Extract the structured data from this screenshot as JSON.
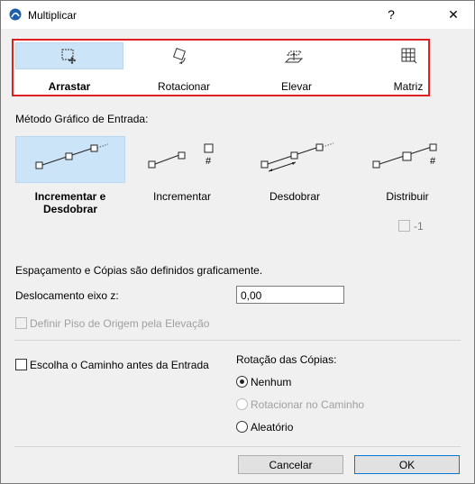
{
  "window": {
    "title": "Multiplicar",
    "help_glyph": "?",
    "close_glyph": "✕"
  },
  "modes": [
    {
      "label": "Arrastar",
      "icon": "drag-icon",
      "selected": true
    },
    {
      "label": "Rotacionar",
      "icon": "rotate-icon",
      "selected": false
    },
    {
      "label": "Elevar",
      "icon": "elevate-icon",
      "selected": false
    },
    {
      "label": "Matriz",
      "icon": "matrix-icon",
      "selected": false
    }
  ],
  "method_section": {
    "label": "Método Gráfico de Entrada:",
    "options": [
      {
        "label_line1": "Incrementar e",
        "label_line2": "Desdobrar",
        "selected": true
      },
      {
        "label_line1": "Incrementar",
        "label_line2": "",
        "selected": false
      },
      {
        "label_line1": "Desdobrar",
        "label_line2": "",
        "selected": false
      },
      {
        "label_line1": "Distribuir",
        "label_line2": "",
        "selected": false
      }
    ],
    "minus_one_label": "-1"
  },
  "spacing_note": "Espaçamento e Cópias são definidos graficamente.",
  "z_offset": {
    "label": "Deslocamento eixo z:",
    "value": "0,00"
  },
  "define_floor": {
    "label": "Definir Piso de Origem pela Elevação",
    "checked": false,
    "enabled": false
  },
  "choose_path": {
    "label": "Escolha o Caminho antes da Entrada",
    "checked": false
  },
  "rotation": {
    "label": "Rotação das Cópias:",
    "options": [
      {
        "label": "Nenhum",
        "selected": true,
        "enabled": true
      },
      {
        "label": "Rotacionar no Caminho",
        "selected": false,
        "enabled": false
      },
      {
        "label": "Aleatório",
        "selected": false,
        "enabled": true
      }
    ]
  },
  "buttons": {
    "cancel": "Cancelar",
    "ok": "OK"
  },
  "colors": {
    "highlight": "#e0201f",
    "selection": "#cce4f7",
    "primary_border": "#0078d7"
  }
}
